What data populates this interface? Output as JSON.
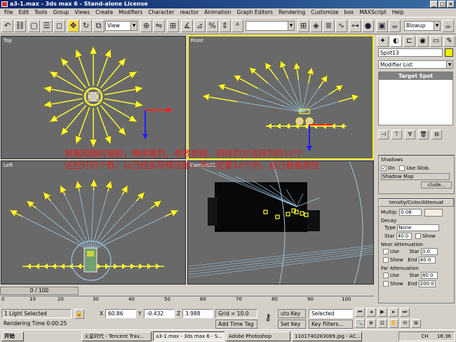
{
  "window": {
    "title": "a3-1.max - 3ds max 6 - Stand-alone License",
    "controls": [
      "_",
      "□",
      "×"
    ]
  },
  "menu": [
    "File",
    "Edit",
    "Tools",
    "Group",
    "Views",
    "Create",
    "Modifiers",
    "Character",
    "reactor",
    "Animation",
    "Graph Editors",
    "Rendering",
    "Customize",
    "box",
    "MAXScript",
    "Help"
  ],
  "toolbar": {
    "view_select": "View",
    "selection_set": "",
    "render_type": "Blowup"
  },
  "viewports": {
    "top": "Top",
    "front": "Front",
    "left": "Left",
    "camera": "Camera01"
  },
  "annotation": {
    "line1": "根据周围的辐射，略带暖色，参数如图，同样的方法阵列的18个",
    "line2": "这些灯的个数，以已经实际情况给，不一定要18个的，自己看着感觉"
  },
  "command_panel": {
    "object_name": "Spot13",
    "object_color": "#f0f000",
    "modifier_list": "Modifier List",
    "stack_item": "Target Spot",
    "shadows": {
      "title": "Shadows",
      "on_label": "On",
      "on_checked": true,
      "use_global": "Use Glob.",
      "type": "Shadow Map",
      "exclude": "clude..."
    },
    "intensity": {
      "title": "tensity/Color/Attenuat",
      "multiplier_label": "Multip:",
      "multiplier": "0.08",
      "light_color": "#f2ebdf"
    },
    "decay": {
      "title": "Decay",
      "type_label": "Type",
      "type": "None",
      "start_label": "Star",
      "start": "40.0",
      "show": "Show"
    },
    "near_atten": {
      "title": "Near Attenuation",
      "use": "Use",
      "show": "Show",
      "start_label": "Star",
      "start": "0.0",
      "end_label": "End",
      "end": "40.0"
    },
    "far_atten": {
      "title": "Far Attenuation",
      "use": "Use",
      "show": "Show",
      "start_label": "Star",
      "start": "80.0",
      "end_label": "End",
      "end": "200.0"
    }
  },
  "timeline": {
    "frame": "0 / 100",
    "ticks": [
      "0",
      "10",
      "20",
      "30",
      "40",
      "50",
      "60",
      "70",
      "80",
      "90",
      "100"
    ]
  },
  "status": {
    "selection": "1 Light Selected",
    "render_time": "Rendering Time  0:00:25",
    "x_label": "X",
    "x": "60.86",
    "y_label": "Y",
    "y": "-0.432",
    "z_label": "Z",
    "z": "3.988",
    "grid": "Grid = 10.0",
    "add_time_tag": "Add Time Tag",
    "auto_key": "uto Key",
    "set_key": "Set Key",
    "selected": "Selected",
    "key_filters": "Key Filters..."
  },
  "taskbar": {
    "start": "开始",
    "tasks": [
      "火星时代 - Tencent Trav...",
      "a3-1.max - 3ds max 6 - S...",
      "Adobe Photoshop",
      "1101740283089.jpg - AC..."
    ],
    "active_task": 1,
    "time": "16:36",
    "tray_lang": "CH"
  }
}
